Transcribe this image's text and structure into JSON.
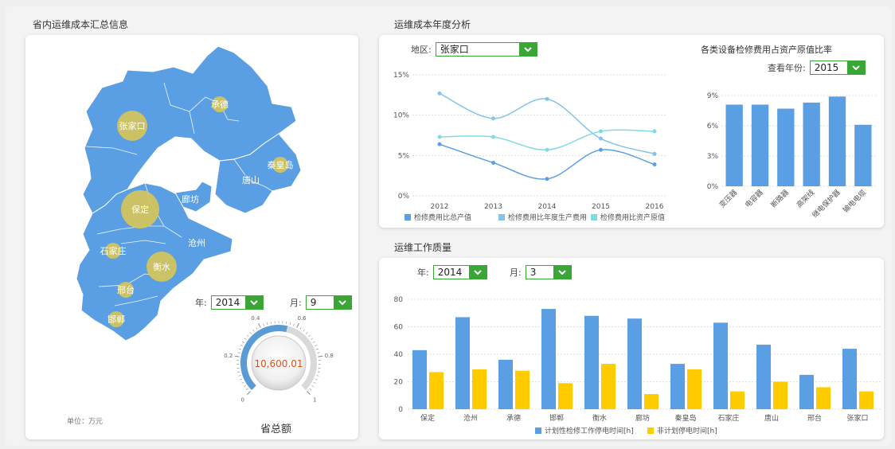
{
  "map_section": {
    "title": "省内运维成本汇总信息",
    "unit_label": "单位：万元",
    "year_label": "年:",
    "year_value": "2014",
    "month_label": "月:",
    "month_value": "9",
    "total_value": "10,600.01",
    "total_label": "省总额",
    "map_color": "#5a9fe3",
    "bubble_color": "#d4c45a",
    "gauge": {
      "ticks": [
        "0",
        "0.2",
        "0.4",
        "0.6",
        "0.8",
        "1"
      ],
      "value_fraction": 0.55,
      "color": "#5b9bd5"
    },
    "regions": [
      {
        "name": "承德",
        "size": "small"
      },
      {
        "name": "张家口",
        "size": "medium"
      },
      {
        "name": "秦皇岛",
        "size": "small"
      },
      {
        "name": "唐山",
        "size": "none"
      },
      {
        "name": "廊坊",
        "size": "none"
      },
      {
        "name": "保定",
        "size": "large"
      },
      {
        "name": "沧州",
        "size": "none"
      },
      {
        "name": "石家庄",
        "size": "small"
      },
      {
        "name": "衡水",
        "size": "medium"
      },
      {
        "name": "邢台",
        "size": "small"
      },
      {
        "name": "邯郸",
        "size": "small"
      }
    ]
  },
  "annual_section": {
    "title": "运维成本年度分析",
    "region_label": "地区:",
    "region_value": "张家口",
    "ratio_title": "各类设备检修费用占资产原值比率",
    "ratio_year_label": "查看年份:",
    "ratio_year_value": "2015"
  },
  "quality_section": {
    "title": "运维工作质量",
    "year_label": "年:",
    "year_value": "2014",
    "month_label": "月:",
    "month_value": "3"
  },
  "chart_data": [
    {
      "type": "line",
      "x": [
        "2012",
        "2013",
        "2014",
        "2015",
        "2016"
      ],
      "ylim": [
        0,
        15
      ],
      "yticks": [
        "0%",
        "5%",
        "10%",
        "15%"
      ],
      "grid": true,
      "legend_position": "bottom",
      "series": [
        {
          "name": "检修费用比总产值",
          "color": "#5a9fe3",
          "values": [
            6.4,
            4.1,
            2.1,
            5.7,
            3.9
          ]
        },
        {
          "name": "检修费用比年度生产费用",
          "color": "#85c4e6",
          "values": [
            12.7,
            9.6,
            12.0,
            7.1,
            5.2
          ]
        },
        {
          "name": "检修费用比资产原值",
          "color": "#7fdbe3",
          "values": [
            7.3,
            7.3,
            5.7,
            8.0,
            8.0
          ]
        }
      ]
    },
    {
      "type": "bar",
      "categories": [
        "变压器",
        "电容器",
        "断路器",
        "高架线",
        "继电保护器",
        "输电电缆"
      ],
      "values": [
        8.1,
        8.1,
        7.7,
        8.3,
        8.9,
        6.1
      ],
      "ylim": [
        0,
        9
      ],
      "yticks": [
        "0%",
        "3%",
        "6%",
        "9%"
      ],
      "grid": true,
      "color": "#5a9fe3"
    },
    {
      "type": "bar",
      "categories": [
        "保定",
        "沧州",
        "承德",
        "邯郸",
        "衡水",
        "廊坊",
        "秦皇岛",
        "石家庄",
        "唐山",
        "邢台",
        "张家口"
      ],
      "ylim": [
        0,
        80
      ],
      "yticks": [
        "0",
        "20",
        "40",
        "60",
        "80"
      ],
      "grid": true,
      "legend_position": "bottom",
      "series": [
        {
          "name": "计划性检修工作停电时间[h]",
          "color": "#5a9fe3",
          "values": [
            43,
            67,
            36,
            73,
            68,
            66,
            33,
            63,
            47,
            25,
            44
          ]
        },
        {
          "name": "非计划停电时间[h]",
          "color": "#ffcc00",
          "values": [
            27,
            29,
            28,
            19,
            33,
            11,
            29,
            13,
            20,
            16,
            13
          ]
        }
      ]
    }
  ]
}
